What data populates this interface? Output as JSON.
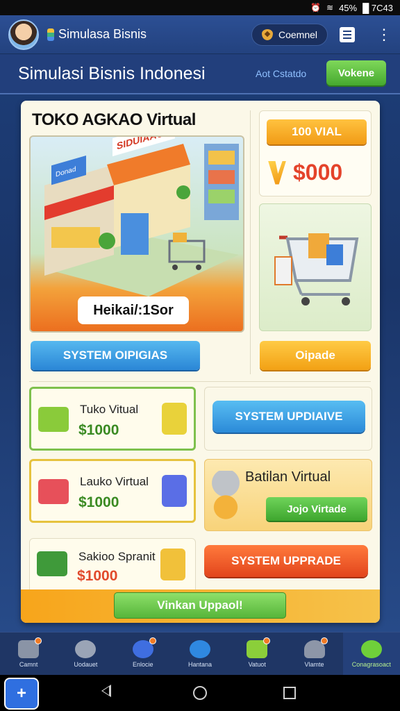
{
  "status_bar": {
    "battery": "45%",
    "carrier": "█ 7C43"
  },
  "app_bar": {
    "title": "Simulasa Bisnis",
    "channel_label": "Coemnel"
  },
  "header": {
    "title": "Simulasi Bisnis Indonesi",
    "subtitle_link": "Aot Cstatdo",
    "action_label": "Vokene"
  },
  "shop": {
    "title": "TOKO AGKAO Virtual",
    "sign": "SIDUIAAG",
    "banner_sign": "Donad",
    "overlay_label": "Heikai/:1Sor",
    "price_tag": "100 VIAL",
    "price": "$000",
    "system_button": "SYSTEM OIPIGIAS",
    "upgrade_button": "Oipade"
  },
  "items": [
    {
      "name": "Tuko Vitual",
      "price": "$1000"
    },
    {
      "name": "Lauko Virtual",
      "price": "$1000"
    },
    {
      "name": "Sakioo Spranit",
      "price": "$1000"
    }
  ],
  "panels": {
    "system_update_button": "SYSTEM UPDIAIVE",
    "batilan_title": "Batilan Virtual",
    "batilan_button": "Jojo Virtade",
    "system_upgrade_button": "SYSTEM UPPRADE",
    "main_upgrade_button": "Vinkan Uppaol!"
  },
  "bottom_nav": [
    {
      "label": "Camnt",
      "icon": "truck-icon",
      "color": "#8a94a6"
    },
    {
      "label": "Uodauet",
      "icon": "gear-icon",
      "color": "#9aa4b6"
    },
    {
      "label": "Enlocie",
      "icon": "chat-icon",
      "color": "#3f6ee0"
    },
    {
      "label": "Hantana",
      "icon": "globe-icon",
      "color": "#2f88e0"
    },
    {
      "label": "Vatuot",
      "icon": "battery-icon",
      "color": "#8bcf3a"
    },
    {
      "label": "Vlamte",
      "icon": "helmet-icon",
      "color": "#8d96a8"
    },
    {
      "label": "Conagrasoact",
      "icon": "settings-icon",
      "color": "#6fd03a"
    }
  ]
}
